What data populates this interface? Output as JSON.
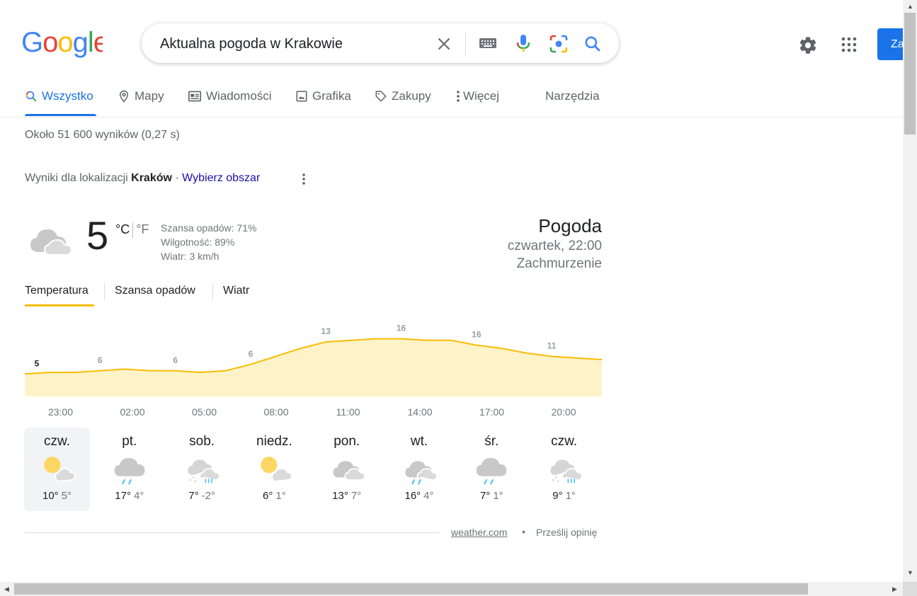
{
  "logo": {
    "text": "Google",
    "colors": [
      "#4285f4",
      "#ea4335",
      "#fbbc05",
      "#4285f4",
      "#34a853",
      "#ea4335"
    ]
  },
  "search": {
    "query": "Aktualna pogoda w Krakowie"
  },
  "header": {
    "signin_label": "Za"
  },
  "tabs": [
    {
      "label": "Wszystko",
      "icon": "search-icon",
      "active": true
    },
    {
      "label": "Mapy",
      "icon": "map-pin-icon"
    },
    {
      "label": "Wiadomości",
      "icon": "news-icon"
    },
    {
      "label": "Grafika",
      "icon": "image-icon"
    },
    {
      "label": "Zakupy",
      "icon": "tag-icon"
    },
    {
      "label": "Więcej",
      "icon": "more-vert-icon"
    },
    {
      "label": "Narzędzia"
    }
  ],
  "results_stats": "Około 51 600 wyników (0,27 s)",
  "location": {
    "prefix": "Wyniki dla lokalizacji",
    "city": "Kraków",
    "separator": "·",
    "change_link": "Wybierz obszar"
  },
  "weather": {
    "temp": "5",
    "unit_c": "°C",
    "unit_f": "°F",
    "precip": "Szansa opadów: 71%",
    "humidity": "Wilgotność: 89%",
    "wind": "Wiatr: 3 km/h",
    "title": "Pogoda",
    "time": "czwartek, 22:00",
    "condition": "Zachmurzenie",
    "condition_icon": "cloudy-icon",
    "tabs": [
      "Temperatura",
      "Szansa opadów",
      "Wiatr"
    ],
    "active_tab": 0,
    "accent_color": "#fbbc04"
  },
  "chart_data": {
    "type": "area",
    "x": [
      "23:00",
      "00:00",
      "01:00",
      "02:00",
      "03:00",
      "04:00",
      "05:00",
      "06:00",
      "07:00",
      "08:00",
      "09:00",
      "10:00",
      "11:00",
      "12:00",
      "13:00",
      "14:00",
      "15:00",
      "16:00",
      "17:00",
      "18:00",
      "19:00",
      "20:00",
      "21:00",
      "22:00"
    ],
    "values": [
      5,
      5.5,
      5.5,
      6,
      6.5,
      6,
      6,
      5.5,
      6,
      8,
      10.5,
      13,
      15,
      15.5,
      16,
      16,
      15.5,
      15.5,
      14,
      13,
      11.5,
      10.5,
      10,
      9.5
    ],
    "labeled": [
      {
        "index": 0,
        "label": "5"
      },
      {
        "index": 3,
        "label": "6"
      },
      {
        "index": 6,
        "label": "6"
      },
      {
        "index": 9,
        "label": "6"
      },
      {
        "index": 12,
        "label": "13"
      },
      {
        "index": 15,
        "label": "16"
      },
      {
        "index": 18,
        "label": "16"
      },
      {
        "index": 21,
        "label": "11"
      }
    ],
    "tick_labels": [
      "23:00",
      "02:00",
      "05:00",
      "08:00",
      "11:00",
      "14:00",
      "17:00",
      "20:00"
    ],
    "line_color": "#fbbc04",
    "fill_color": "#fef3c8",
    "ylim": [
      -2,
      19
    ]
  },
  "days": [
    {
      "name": "czw.",
      "hi": "10°",
      "lo": "5°",
      "icon": "partly-cloudy-icon",
      "active": true
    },
    {
      "name": "pt.",
      "hi": "17°",
      "lo": "4°",
      "icon": "rain-icon"
    },
    {
      "name": "sob.",
      "hi": "7°",
      "lo": "-2°",
      "icon": "snow-rain-icon"
    },
    {
      "name": "niedz.",
      "hi": "6°",
      "lo": "1°",
      "icon": "partly-cloudy-icon"
    },
    {
      "name": "pon.",
      "hi": "13°",
      "lo": "7°",
      "icon": "cloudy-icon"
    },
    {
      "name": "wt.",
      "hi": "16°",
      "lo": "4°",
      "icon": "showers-icon"
    },
    {
      "name": "śr.",
      "hi": "7°",
      "lo": "1°",
      "icon": "rain-icon"
    },
    {
      "name": "czw.",
      "hi": "9°",
      "lo": "1°",
      "icon": "snow-rain-icon"
    }
  ],
  "footer": {
    "source": "weather.com",
    "dot": "•",
    "feedback": "Prześlij opinię"
  }
}
